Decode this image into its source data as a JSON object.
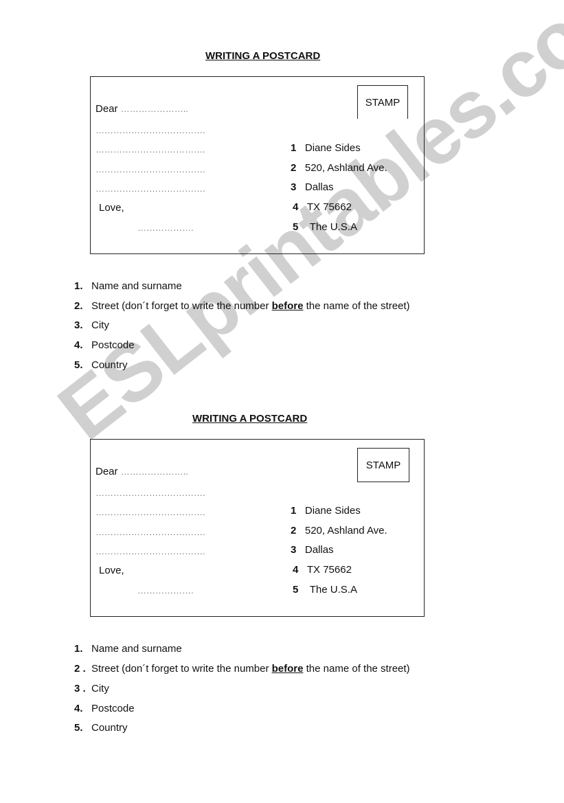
{
  "watermark": "ESLprintables.com",
  "sections": [
    {
      "title": "WRITING A POSTCARD",
      "card": {
        "dear_label": "Dear",
        "dear_dots": "…………………..",
        "body_lines": [
          "……………………………….",
          "……………………………….",
          "……………………………….",
          "………………………………."
        ],
        "closing": "Love,",
        "signature_dots": "……………….",
        "stamp_label": "STAMP",
        "address": [
          {
            "num": "1",
            "text": "Diane Sides"
          },
          {
            "num": "2",
            "text": "520, Ashland Ave."
          },
          {
            "num": "3",
            "text": "Dallas"
          },
          {
            "num": "4",
            "text": "TX 75662"
          },
          {
            "num": "5",
            "text": " The U.S.A"
          }
        ]
      },
      "legend": [
        {
          "num": "1.",
          "text": "Name and surname"
        },
        {
          "num": "2.",
          "pre": "Street (don´t forget to write the number ",
          "bold": "before",
          "post": " the name of the street)"
        },
        {
          "num": "3.",
          "text": "City"
        },
        {
          "num": "4.",
          "text": "Postcode"
        },
        {
          "num": "5.",
          "text": "Country"
        }
      ]
    },
    {
      "title": "WRITING A POSTCARD",
      "card": {
        "dear_label": "Dear",
        "dear_dots": "…………………..",
        "body_lines": [
          "……………………………….",
          "……………………………….",
          "……………………………….",
          "………………………………."
        ],
        "closing": "Love,",
        "signature_dots": "……………….",
        "stamp_label": "STAMP",
        "address": [
          {
            "num": "1",
            "text": "Diane Sides"
          },
          {
            "num": "2",
            "text": "520, Ashland Ave."
          },
          {
            "num": "3",
            "text": "Dallas"
          },
          {
            "num": "4",
            "text": "TX 75662"
          },
          {
            "num": "5",
            "text": " The U.S.A"
          }
        ]
      },
      "legend": [
        {
          "num": "1.",
          "text": "Name and surname"
        },
        {
          "num": "2 .",
          "pre": "Street (don´t forget to write the number ",
          "bold": "before",
          "post": " the name of the street)"
        },
        {
          "num": "3 .",
          "text": "City"
        },
        {
          "num": "4.",
          "text": "Postcode"
        },
        {
          "num": "5.",
          "text": "Country"
        }
      ]
    }
  ]
}
